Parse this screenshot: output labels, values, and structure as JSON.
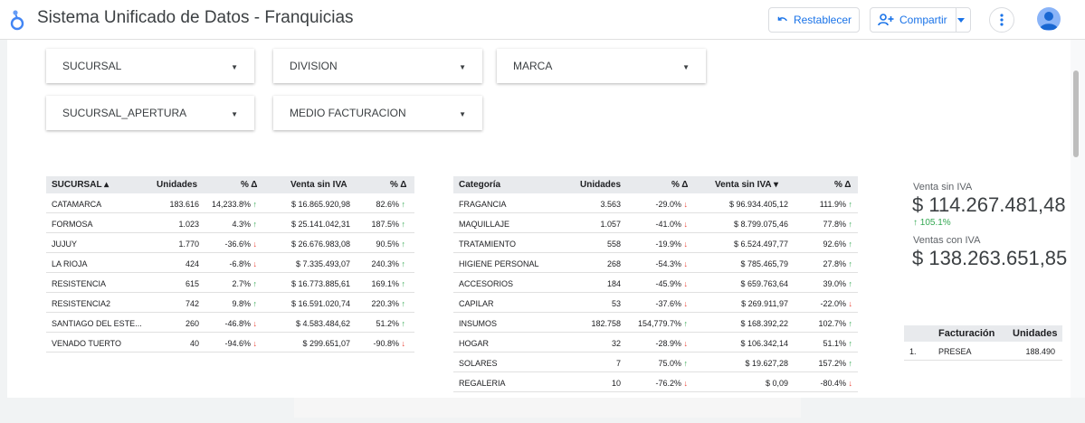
{
  "app": {
    "title": "Sistema Unificado de Datos - Franquicias"
  },
  "toolbar": {
    "reset_label": "Restablecer",
    "share_label": "Compartir"
  },
  "filters": [
    {
      "label": "SUCURSAL"
    },
    {
      "label": "DIVISION"
    },
    {
      "label": "MARCA"
    },
    {
      "label": "SUCURSAL_APERTURA"
    },
    {
      "label": "MEDIO FACTURACION"
    }
  ],
  "colors": {
    "accent": "#1a73e8",
    "up": "#34a853",
    "down": "#ea4335",
    "header_bg": "#e8eaed"
  },
  "sucursal_table": {
    "headers": [
      "SUCURSAL ▴",
      "Unidades",
      "% Δ",
      "Venta sin IVA",
      "% Δ"
    ],
    "rows": [
      {
        "name": "CATAMARCA",
        "unidades": "183.616",
        "pct1": "14,233.8%",
        "pct1_dir": "up",
        "venta": "$ 16.865.920,98",
        "pct2": "82.6%",
        "pct2_dir": "up"
      },
      {
        "name": "FORMOSA",
        "unidades": "1.023",
        "pct1": "4.3%",
        "pct1_dir": "up",
        "venta": "$ 25.141.042,31",
        "pct2": "187.5%",
        "pct2_dir": "up"
      },
      {
        "name": "JUJUY",
        "unidades": "1.770",
        "pct1": "-36.6%",
        "pct1_dir": "down",
        "venta": "$ 26.676.983,08",
        "pct2": "90.5%",
        "pct2_dir": "up"
      },
      {
        "name": "LA RIOJA",
        "unidades": "424",
        "pct1": "-6.8%",
        "pct1_dir": "down",
        "venta": "$ 7.335.493,07",
        "pct2": "240.3%",
        "pct2_dir": "up"
      },
      {
        "name": "RESISTENCIA",
        "unidades": "615",
        "pct1": "2.7%",
        "pct1_dir": "up",
        "venta": "$ 16.773.885,61",
        "pct2": "169.1%",
        "pct2_dir": "up"
      },
      {
        "name": "RESISTENCIA2",
        "unidades": "742",
        "pct1": "9.8%",
        "pct1_dir": "up",
        "venta": "$ 16.591.020,74",
        "pct2": "220.3%",
        "pct2_dir": "up"
      },
      {
        "name": "SANTIAGO DEL ESTE...",
        "unidades": "260",
        "pct1": "-46.8%",
        "pct1_dir": "down",
        "venta": "$ 4.583.484,62",
        "pct2": "51.2%",
        "pct2_dir": "up"
      },
      {
        "name": "VENADO TUERTO",
        "unidades": "40",
        "pct1": "-94.6%",
        "pct1_dir": "down",
        "venta": "$ 299.651,07",
        "pct2": "-90.8%",
        "pct2_dir": "down"
      }
    ]
  },
  "categoria_table": {
    "headers": [
      "Categoría",
      "Unidades",
      "% Δ",
      "Venta sin IVA ▾",
      "% Δ"
    ],
    "rows": [
      {
        "name": "FRAGANCIA",
        "unidades": "3.563",
        "pct1": "-29.0%",
        "pct1_dir": "down",
        "venta": "$ 96.934.405,12",
        "pct2": "111.9%",
        "pct2_dir": "up"
      },
      {
        "name": "MAQUILLAJE",
        "unidades": "1.057",
        "pct1": "-41.0%",
        "pct1_dir": "down",
        "venta": "$ 8.799.075,46",
        "pct2": "77.8%",
        "pct2_dir": "up"
      },
      {
        "name": "TRATAMIENTO",
        "unidades": "558",
        "pct1": "-19.9%",
        "pct1_dir": "down",
        "venta": "$ 6.524.497,77",
        "pct2": "92.6%",
        "pct2_dir": "up"
      },
      {
        "name": "HIGIENE PERSONAL",
        "unidades": "268",
        "pct1": "-54.3%",
        "pct1_dir": "down",
        "venta": "$ 785.465,79",
        "pct2": "27.8%",
        "pct2_dir": "up"
      },
      {
        "name": "ACCESORIOS",
        "unidades": "184",
        "pct1": "-45.9%",
        "pct1_dir": "down",
        "venta": "$ 659.763,64",
        "pct2": "39.0%",
        "pct2_dir": "up"
      },
      {
        "name": "CAPILAR",
        "unidades": "53",
        "pct1": "-37.6%",
        "pct1_dir": "down",
        "venta": "$ 269.911,97",
        "pct2": "-22.0%",
        "pct2_dir": "down"
      },
      {
        "name": "INSUMOS",
        "unidades": "182.758",
        "pct1": "154,779.7%",
        "pct1_dir": "up",
        "venta": "$ 168.392,22",
        "pct2": "102.7%",
        "pct2_dir": "up"
      },
      {
        "name": "HOGAR",
        "unidades": "32",
        "pct1": "-28.9%",
        "pct1_dir": "down",
        "venta": "$ 106.342,14",
        "pct2": "51.1%",
        "pct2_dir": "up"
      },
      {
        "name": "SOLARES",
        "unidades": "7",
        "pct1": "75.0%",
        "pct1_dir": "up",
        "venta": "$ 19.627,28",
        "pct2": "157.2%",
        "pct2_dir": "up"
      },
      {
        "name": "REGALERIA",
        "unidades": "10",
        "pct1": "-76.2%",
        "pct1_dir": "down",
        "venta": "$ 0,09",
        "pct2": "-80.4%",
        "pct2_dir": "down"
      }
    ]
  },
  "scorecards": {
    "venta_sin_iva_label": "Venta sin IVA",
    "venta_sin_iva_value": "$ 114.267.481,48",
    "venta_sin_iva_delta": "105.1%",
    "ventas_con_iva_label": "Ventas con IVA",
    "ventas_con_iva_value": "$ 138.263.651,85"
  },
  "facturacion_table": {
    "headers": [
      "Facturación",
      "Unidades"
    ],
    "rows": [
      {
        "index": "1.",
        "name": "PRESEA",
        "unidades": "188.490"
      }
    ]
  }
}
